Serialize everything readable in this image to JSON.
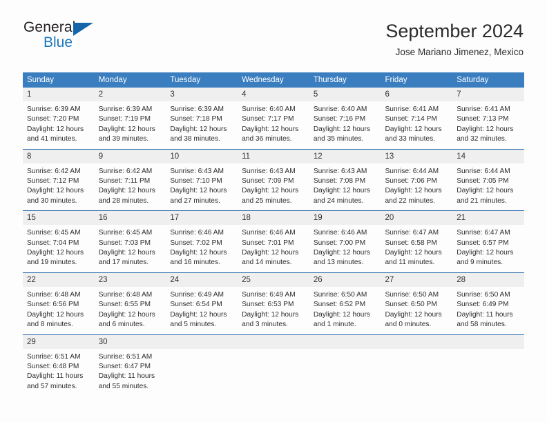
{
  "brand": {
    "name_part1": "General",
    "name_part2": "Blue",
    "accent_color": "#1b76bc",
    "triangle_color": "#1565a8"
  },
  "header": {
    "title": "September 2024",
    "subtitle": "Jose Mariano Jimenez, Mexico"
  },
  "calendar": {
    "header_bg": "#3a7ebf",
    "daynum_bg": "#efefef",
    "row_divider": "#2b6cad",
    "weekday_headers": [
      "Sunday",
      "Monday",
      "Tuesday",
      "Wednesday",
      "Thursday",
      "Friday",
      "Saturday"
    ],
    "weeks": [
      [
        {
          "day": "1",
          "sunrise": "Sunrise: 6:39 AM",
          "sunset": "Sunset: 7:20 PM",
          "daylight1": "Daylight: 12 hours",
          "daylight2": "and 41 minutes."
        },
        {
          "day": "2",
          "sunrise": "Sunrise: 6:39 AM",
          "sunset": "Sunset: 7:19 PM",
          "daylight1": "Daylight: 12 hours",
          "daylight2": "and 39 minutes."
        },
        {
          "day": "3",
          "sunrise": "Sunrise: 6:39 AM",
          "sunset": "Sunset: 7:18 PM",
          "daylight1": "Daylight: 12 hours",
          "daylight2": "and 38 minutes."
        },
        {
          "day": "4",
          "sunrise": "Sunrise: 6:40 AM",
          "sunset": "Sunset: 7:17 PM",
          "daylight1": "Daylight: 12 hours",
          "daylight2": "and 36 minutes."
        },
        {
          "day": "5",
          "sunrise": "Sunrise: 6:40 AM",
          "sunset": "Sunset: 7:16 PM",
          "daylight1": "Daylight: 12 hours",
          "daylight2": "and 35 minutes."
        },
        {
          "day": "6",
          "sunrise": "Sunrise: 6:41 AM",
          "sunset": "Sunset: 7:14 PM",
          "daylight1": "Daylight: 12 hours",
          "daylight2": "and 33 minutes."
        },
        {
          "day": "7",
          "sunrise": "Sunrise: 6:41 AM",
          "sunset": "Sunset: 7:13 PM",
          "daylight1": "Daylight: 12 hours",
          "daylight2": "and 32 minutes."
        }
      ],
      [
        {
          "day": "8",
          "sunrise": "Sunrise: 6:42 AM",
          "sunset": "Sunset: 7:12 PM",
          "daylight1": "Daylight: 12 hours",
          "daylight2": "and 30 minutes."
        },
        {
          "day": "9",
          "sunrise": "Sunrise: 6:42 AM",
          "sunset": "Sunset: 7:11 PM",
          "daylight1": "Daylight: 12 hours",
          "daylight2": "and 28 minutes."
        },
        {
          "day": "10",
          "sunrise": "Sunrise: 6:43 AM",
          "sunset": "Sunset: 7:10 PM",
          "daylight1": "Daylight: 12 hours",
          "daylight2": "and 27 minutes."
        },
        {
          "day": "11",
          "sunrise": "Sunrise: 6:43 AM",
          "sunset": "Sunset: 7:09 PM",
          "daylight1": "Daylight: 12 hours",
          "daylight2": "and 25 minutes."
        },
        {
          "day": "12",
          "sunrise": "Sunrise: 6:43 AM",
          "sunset": "Sunset: 7:08 PM",
          "daylight1": "Daylight: 12 hours",
          "daylight2": "and 24 minutes."
        },
        {
          "day": "13",
          "sunrise": "Sunrise: 6:44 AM",
          "sunset": "Sunset: 7:06 PM",
          "daylight1": "Daylight: 12 hours",
          "daylight2": "and 22 minutes."
        },
        {
          "day": "14",
          "sunrise": "Sunrise: 6:44 AM",
          "sunset": "Sunset: 7:05 PM",
          "daylight1": "Daylight: 12 hours",
          "daylight2": "and 21 minutes."
        }
      ],
      [
        {
          "day": "15",
          "sunrise": "Sunrise: 6:45 AM",
          "sunset": "Sunset: 7:04 PM",
          "daylight1": "Daylight: 12 hours",
          "daylight2": "and 19 minutes."
        },
        {
          "day": "16",
          "sunrise": "Sunrise: 6:45 AM",
          "sunset": "Sunset: 7:03 PM",
          "daylight1": "Daylight: 12 hours",
          "daylight2": "and 17 minutes."
        },
        {
          "day": "17",
          "sunrise": "Sunrise: 6:46 AM",
          "sunset": "Sunset: 7:02 PM",
          "daylight1": "Daylight: 12 hours",
          "daylight2": "and 16 minutes."
        },
        {
          "day": "18",
          "sunrise": "Sunrise: 6:46 AM",
          "sunset": "Sunset: 7:01 PM",
          "daylight1": "Daylight: 12 hours",
          "daylight2": "and 14 minutes."
        },
        {
          "day": "19",
          "sunrise": "Sunrise: 6:46 AM",
          "sunset": "Sunset: 7:00 PM",
          "daylight1": "Daylight: 12 hours",
          "daylight2": "and 13 minutes."
        },
        {
          "day": "20",
          "sunrise": "Sunrise: 6:47 AM",
          "sunset": "Sunset: 6:58 PM",
          "daylight1": "Daylight: 12 hours",
          "daylight2": "and 11 minutes."
        },
        {
          "day": "21",
          "sunrise": "Sunrise: 6:47 AM",
          "sunset": "Sunset: 6:57 PM",
          "daylight1": "Daylight: 12 hours",
          "daylight2": "and 9 minutes."
        }
      ],
      [
        {
          "day": "22",
          "sunrise": "Sunrise: 6:48 AM",
          "sunset": "Sunset: 6:56 PM",
          "daylight1": "Daylight: 12 hours",
          "daylight2": "and 8 minutes."
        },
        {
          "day": "23",
          "sunrise": "Sunrise: 6:48 AM",
          "sunset": "Sunset: 6:55 PM",
          "daylight1": "Daylight: 12 hours",
          "daylight2": "and 6 minutes."
        },
        {
          "day": "24",
          "sunrise": "Sunrise: 6:49 AM",
          "sunset": "Sunset: 6:54 PM",
          "daylight1": "Daylight: 12 hours",
          "daylight2": "and 5 minutes."
        },
        {
          "day": "25",
          "sunrise": "Sunrise: 6:49 AM",
          "sunset": "Sunset: 6:53 PM",
          "daylight1": "Daylight: 12 hours",
          "daylight2": "and 3 minutes."
        },
        {
          "day": "26",
          "sunrise": "Sunrise: 6:50 AM",
          "sunset": "Sunset: 6:52 PM",
          "daylight1": "Daylight: 12 hours",
          "daylight2": "and 1 minute."
        },
        {
          "day": "27",
          "sunrise": "Sunrise: 6:50 AM",
          "sunset": "Sunset: 6:50 PM",
          "daylight1": "Daylight: 12 hours",
          "daylight2": "and 0 minutes."
        },
        {
          "day": "28",
          "sunrise": "Sunrise: 6:50 AM",
          "sunset": "Sunset: 6:49 PM",
          "daylight1": "Daylight: 11 hours",
          "daylight2": "and 58 minutes."
        }
      ],
      [
        {
          "day": "29",
          "sunrise": "Sunrise: 6:51 AM",
          "sunset": "Sunset: 6:48 PM",
          "daylight1": "Daylight: 11 hours",
          "daylight2": "and 57 minutes."
        },
        {
          "day": "30",
          "sunrise": "Sunrise: 6:51 AM",
          "sunset": "Sunset: 6:47 PM",
          "daylight1": "Daylight: 11 hours",
          "daylight2": "and 55 minutes."
        },
        {
          "day": "",
          "sunrise": "",
          "sunset": "",
          "daylight1": "",
          "daylight2": ""
        },
        {
          "day": "",
          "sunrise": "",
          "sunset": "",
          "daylight1": "",
          "daylight2": ""
        },
        {
          "day": "",
          "sunrise": "",
          "sunset": "",
          "daylight1": "",
          "daylight2": ""
        },
        {
          "day": "",
          "sunrise": "",
          "sunset": "",
          "daylight1": "",
          "daylight2": ""
        },
        {
          "day": "",
          "sunrise": "",
          "sunset": "",
          "daylight1": "",
          "daylight2": ""
        }
      ]
    ]
  }
}
